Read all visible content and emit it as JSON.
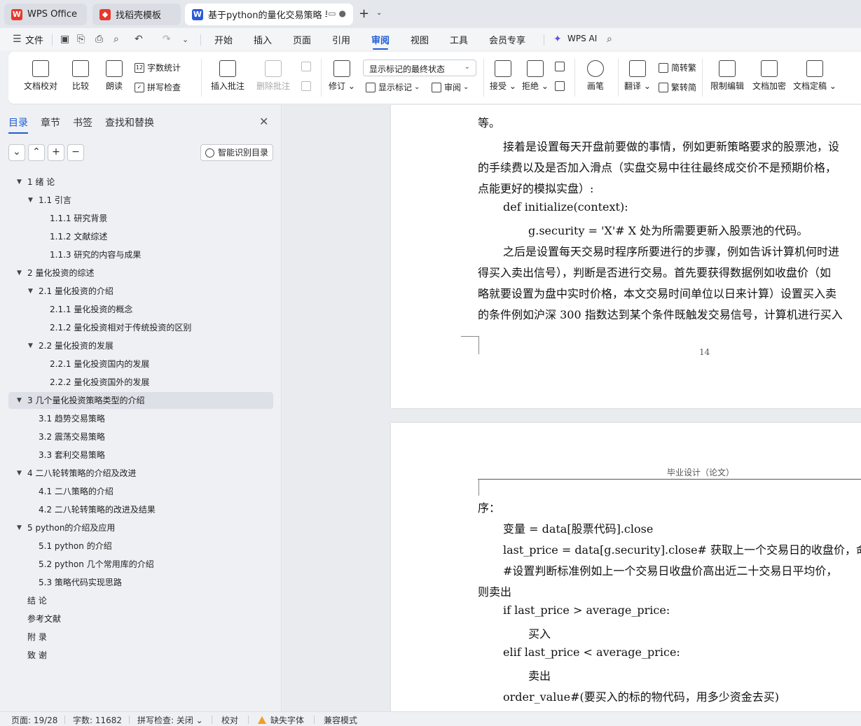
{
  "tabs": [
    {
      "label": "WPS Office",
      "icon": "wps-logo-icon",
      "color": "#e8372c",
      "state": "inactive"
    },
    {
      "label": "找稻壳模板",
      "icon": "docer-icon",
      "color": "#e8372c",
      "state": "inactive"
    },
    {
      "label": "基于python的量化交易策略 毕",
      "icon": "word-doc-icon",
      "color": "#2b5bd7",
      "state": "active"
    }
  ],
  "menubar": {
    "file": "文件",
    "items": [
      "开始",
      "插入",
      "页面",
      "引用",
      "审阅",
      "视图",
      "工具",
      "会员专享"
    ],
    "active": "审阅",
    "ai": "WPS AI"
  },
  "ribbon": {
    "doc_check": "文档校对",
    "compare": "比较",
    "read_aloud": "朗读",
    "word_count": "字数统计",
    "spell_check": "拼写检查",
    "insert_comment": "插入批注",
    "delete_comment": "删除批注",
    "track_changes": "修订",
    "markup_state": "显示标记的最终状态",
    "show_markup": "显示标记",
    "review_pane": "审阅",
    "accept": "接受",
    "reject": "拒绝",
    "pen": "画笔",
    "translate": "翻译",
    "to_traditional": "简转繁",
    "to_simplified": "繁转简",
    "restrict_edit": "限制编辑",
    "encrypt": "文档加密",
    "finalize": "文档定稿"
  },
  "nav": {
    "tabs": [
      "目录",
      "章节",
      "书签",
      "查找和替换"
    ],
    "active_tab": "目录",
    "smart_toc": "智能识别目录",
    "toc": [
      {
        "text": "1  绪  论",
        "level": 0,
        "expand": true
      },
      {
        "text": "1.1  引言",
        "level": 1,
        "expand": true
      },
      {
        "text": "1.1.1  研究背景",
        "level": 2
      },
      {
        "text": "1.1.2  文献综述",
        "level": 2
      },
      {
        "text": "1.1.3  研究的内容与成果",
        "level": 2
      },
      {
        "text": "2  量化投资的综述",
        "level": 0,
        "expand": true
      },
      {
        "text": "2.1  量化投资的介绍",
        "level": 1,
        "expand": true
      },
      {
        "text": "2.1.1  量化投资的概念",
        "level": 2
      },
      {
        "text": "2.1.2  量化投资相对于传统投资的区别",
        "level": 2
      },
      {
        "text": "2.2  量化投资的发展",
        "level": 1,
        "expand": true
      },
      {
        "text": "2.2.1  量化投资国内的发展",
        "level": 2
      },
      {
        "text": "2.2.2  量化投资国外的发展",
        "level": 2
      },
      {
        "text": "3  几个量化投资策略类型的介绍",
        "level": 0,
        "expand": true,
        "selected": true
      },
      {
        "text": "3.1  趋势交易策略",
        "level": 1
      },
      {
        "text": "3.2  震荡交易策略",
        "level": 1
      },
      {
        "text": "3.3  套利交易策略",
        "level": 1
      },
      {
        "text": "4  二八轮转策略的介绍及改进",
        "level": 0,
        "expand": true
      },
      {
        "text": "4.1  二八策略的介绍",
        "level": 1
      },
      {
        "text": "4.2  二八轮转策略的改进及结果",
        "level": 1
      },
      {
        "text": "5  python的介绍及应用",
        "level": 0,
        "expand": true
      },
      {
        "text": "5.1 python 的介绍",
        "level": 1
      },
      {
        "text": "5.2 python 几个常用库的介绍",
        "level": 1
      },
      {
        "text": "5.3  策略代码实现思路",
        "level": 1
      },
      {
        "text": "结  论",
        "level": 0
      },
      {
        "text": "参考文献",
        "level": 0
      },
      {
        "text": "附  录",
        "level": 0
      },
      {
        "text": "致  谢",
        "level": 0
      }
    ]
  },
  "document": {
    "page1_lines": [
      "等。",
      "接着是设置每天开盘前要做的事情，例如更新策略要求的股票池，设",
      "的手续费以及是否加入滑点（实盘交易中往往最终成交价不是预期价格，",
      "点能更好的模拟实盘）:",
      "def initialize(context):",
      "g.security = 'X'# X 处为所需要更新入股票池的代码。",
      "之后是设置每天交易时程序所要进行的步骤，例如告诉计算机何时进",
      "得买入卖出信号），判断是否进行交易。首先要获得数据例如收盘价（如",
      "略就要设置为盘中实时价格，本文交易时间单位以日来计算）设置买入卖",
      "的条件例如沪深 300 指数达到某个条件既触发交易信号，计算机进行买入"
    ],
    "page_number": "14",
    "page2_header": "毕业设计（论文）",
    "page2_lines": [
      "序：",
      "变量  = data[股票代码].close",
      "last_price = data[g.security].close#  获取上一个交易日的收盘价，命名",
      "#设置判断标准例如上一个交易日收盘价高出近二十交易日平均价，",
      "则卖出",
      "if last_price > average_price:",
      "买入",
      "elif last_price < average_price:",
      "卖出",
      "order_value#(要买入的标的物代码，用多少资金去买)"
    ]
  },
  "status": {
    "page": "页面: 19/28",
    "words": "字数: 11682",
    "spell": "拼写检查: 关闭",
    "proofread": "校对",
    "missing_font": "缺失字体",
    "compat": "兼容模式"
  },
  "colors": {
    "accent": "#1f5bd6",
    "warning": "#f0a020"
  }
}
